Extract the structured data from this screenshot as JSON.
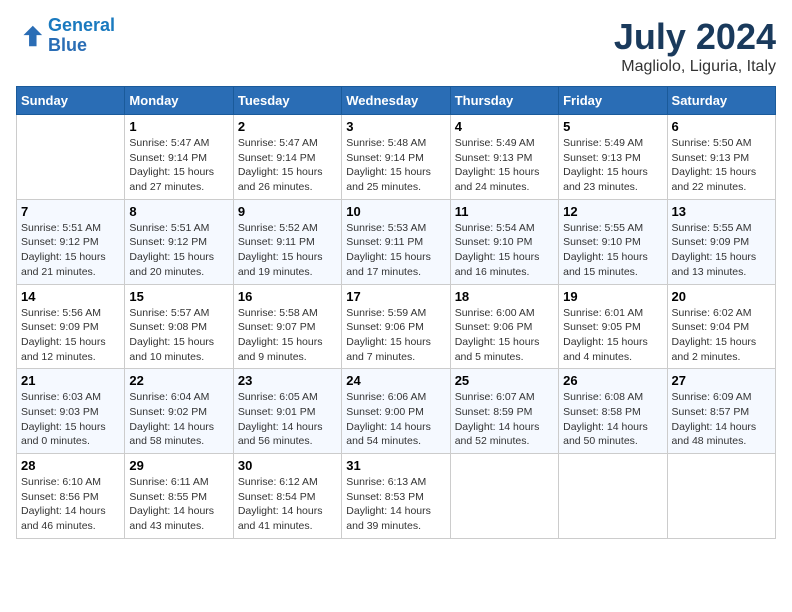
{
  "logo": {
    "line1": "General",
    "line2": "Blue"
  },
  "title": "July 2024",
  "subtitle": "Magliolo, Liguria, Italy",
  "days_of_week": [
    "Sunday",
    "Monday",
    "Tuesday",
    "Wednesday",
    "Thursday",
    "Friday",
    "Saturday"
  ],
  "weeks": [
    [
      {
        "num": "",
        "info": ""
      },
      {
        "num": "1",
        "info": "Sunrise: 5:47 AM\nSunset: 9:14 PM\nDaylight: 15 hours\nand 27 minutes."
      },
      {
        "num": "2",
        "info": "Sunrise: 5:47 AM\nSunset: 9:14 PM\nDaylight: 15 hours\nand 26 minutes."
      },
      {
        "num": "3",
        "info": "Sunrise: 5:48 AM\nSunset: 9:14 PM\nDaylight: 15 hours\nand 25 minutes."
      },
      {
        "num": "4",
        "info": "Sunrise: 5:49 AM\nSunset: 9:13 PM\nDaylight: 15 hours\nand 24 minutes."
      },
      {
        "num": "5",
        "info": "Sunrise: 5:49 AM\nSunset: 9:13 PM\nDaylight: 15 hours\nand 23 minutes."
      },
      {
        "num": "6",
        "info": "Sunrise: 5:50 AM\nSunset: 9:13 PM\nDaylight: 15 hours\nand 22 minutes."
      }
    ],
    [
      {
        "num": "7",
        "info": "Sunrise: 5:51 AM\nSunset: 9:12 PM\nDaylight: 15 hours\nand 21 minutes."
      },
      {
        "num": "8",
        "info": "Sunrise: 5:51 AM\nSunset: 9:12 PM\nDaylight: 15 hours\nand 20 minutes."
      },
      {
        "num": "9",
        "info": "Sunrise: 5:52 AM\nSunset: 9:11 PM\nDaylight: 15 hours\nand 19 minutes."
      },
      {
        "num": "10",
        "info": "Sunrise: 5:53 AM\nSunset: 9:11 PM\nDaylight: 15 hours\nand 17 minutes."
      },
      {
        "num": "11",
        "info": "Sunrise: 5:54 AM\nSunset: 9:10 PM\nDaylight: 15 hours\nand 16 minutes."
      },
      {
        "num": "12",
        "info": "Sunrise: 5:55 AM\nSunset: 9:10 PM\nDaylight: 15 hours\nand 15 minutes."
      },
      {
        "num": "13",
        "info": "Sunrise: 5:55 AM\nSunset: 9:09 PM\nDaylight: 15 hours\nand 13 minutes."
      }
    ],
    [
      {
        "num": "14",
        "info": "Sunrise: 5:56 AM\nSunset: 9:09 PM\nDaylight: 15 hours\nand 12 minutes."
      },
      {
        "num": "15",
        "info": "Sunrise: 5:57 AM\nSunset: 9:08 PM\nDaylight: 15 hours\nand 10 minutes."
      },
      {
        "num": "16",
        "info": "Sunrise: 5:58 AM\nSunset: 9:07 PM\nDaylight: 15 hours\nand 9 minutes."
      },
      {
        "num": "17",
        "info": "Sunrise: 5:59 AM\nSunset: 9:06 PM\nDaylight: 15 hours\nand 7 minutes."
      },
      {
        "num": "18",
        "info": "Sunrise: 6:00 AM\nSunset: 9:06 PM\nDaylight: 15 hours\nand 5 minutes."
      },
      {
        "num": "19",
        "info": "Sunrise: 6:01 AM\nSunset: 9:05 PM\nDaylight: 15 hours\nand 4 minutes."
      },
      {
        "num": "20",
        "info": "Sunrise: 6:02 AM\nSunset: 9:04 PM\nDaylight: 15 hours\nand 2 minutes."
      }
    ],
    [
      {
        "num": "21",
        "info": "Sunrise: 6:03 AM\nSunset: 9:03 PM\nDaylight: 15 hours\nand 0 minutes."
      },
      {
        "num": "22",
        "info": "Sunrise: 6:04 AM\nSunset: 9:02 PM\nDaylight: 14 hours\nand 58 minutes."
      },
      {
        "num": "23",
        "info": "Sunrise: 6:05 AM\nSunset: 9:01 PM\nDaylight: 14 hours\nand 56 minutes."
      },
      {
        "num": "24",
        "info": "Sunrise: 6:06 AM\nSunset: 9:00 PM\nDaylight: 14 hours\nand 54 minutes."
      },
      {
        "num": "25",
        "info": "Sunrise: 6:07 AM\nSunset: 8:59 PM\nDaylight: 14 hours\nand 52 minutes."
      },
      {
        "num": "26",
        "info": "Sunrise: 6:08 AM\nSunset: 8:58 PM\nDaylight: 14 hours\nand 50 minutes."
      },
      {
        "num": "27",
        "info": "Sunrise: 6:09 AM\nSunset: 8:57 PM\nDaylight: 14 hours\nand 48 minutes."
      }
    ],
    [
      {
        "num": "28",
        "info": "Sunrise: 6:10 AM\nSunset: 8:56 PM\nDaylight: 14 hours\nand 46 minutes."
      },
      {
        "num": "29",
        "info": "Sunrise: 6:11 AM\nSunset: 8:55 PM\nDaylight: 14 hours\nand 43 minutes."
      },
      {
        "num": "30",
        "info": "Sunrise: 6:12 AM\nSunset: 8:54 PM\nDaylight: 14 hours\nand 41 minutes."
      },
      {
        "num": "31",
        "info": "Sunrise: 6:13 AM\nSunset: 8:53 PM\nDaylight: 14 hours\nand 39 minutes."
      },
      {
        "num": "",
        "info": ""
      },
      {
        "num": "",
        "info": ""
      },
      {
        "num": "",
        "info": ""
      }
    ]
  ]
}
